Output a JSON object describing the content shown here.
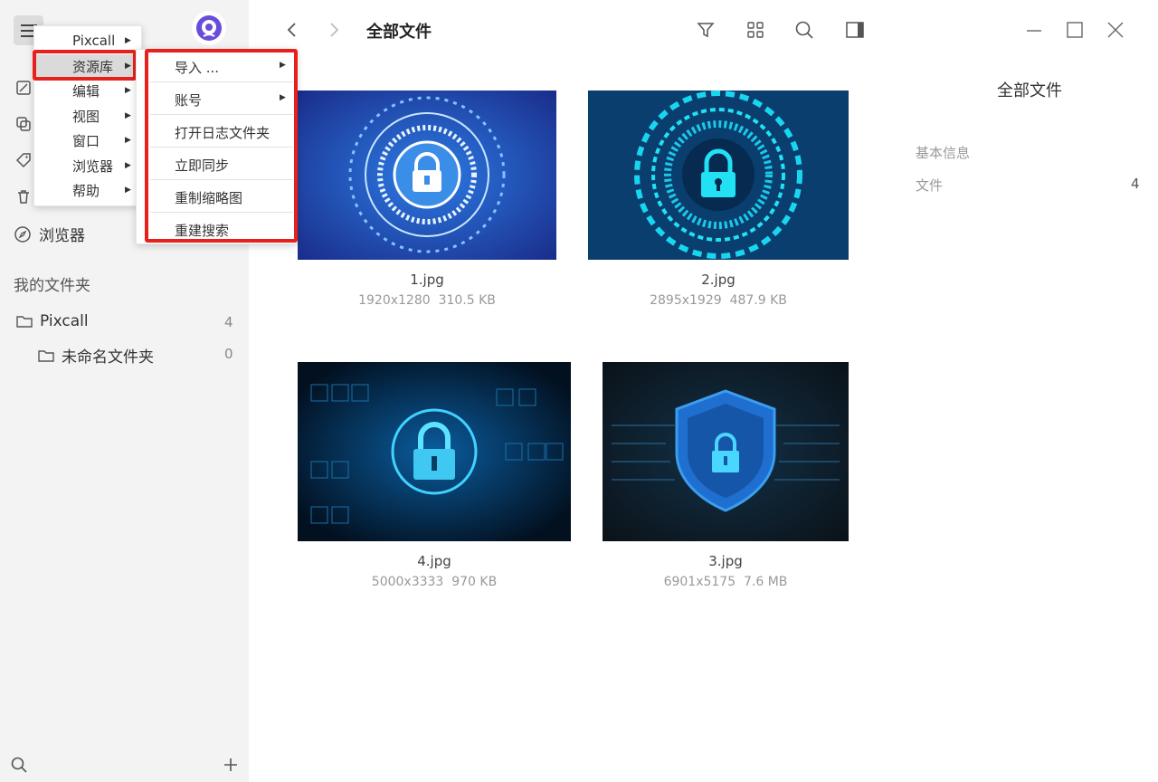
{
  "header": {
    "title": "全部文件"
  },
  "sidebar": {
    "browser_label": "浏览器",
    "section_title": "我的文件夹",
    "folders": [
      {
        "name": "Pixcall",
        "count": "4"
      },
      {
        "name": "未命名文件夹",
        "count": "0"
      }
    ]
  },
  "menu": {
    "items": [
      "Pixcall",
      "资源库",
      "编辑",
      "视图",
      "窗口",
      "浏览器",
      "帮助"
    ],
    "submenu": [
      "导入 ...",
      "账号",
      "打开日志文件夹",
      "立即同步",
      "重制缩略图",
      "重建搜索"
    ]
  },
  "files": [
    {
      "name": "1.jpg",
      "dims": "1920x1280",
      "size": "310.5 KB"
    },
    {
      "name": "2.jpg",
      "dims": "2895x1929",
      "size": "487.9 KB"
    },
    {
      "name": "4.jpg",
      "dims": "5000x3333",
      "size": "970 KB"
    },
    {
      "name": "3.jpg",
      "dims": "6901x5175",
      "size": "7.6 MB"
    }
  ],
  "panel": {
    "title": "全部文件",
    "basic_info": "基本信息",
    "files_label": "文件",
    "files_count": "4"
  },
  "colors": {
    "highlight": "#e8201c",
    "accent": "#6a4cdb",
    "thumb_blue": "#1aa4e8"
  }
}
